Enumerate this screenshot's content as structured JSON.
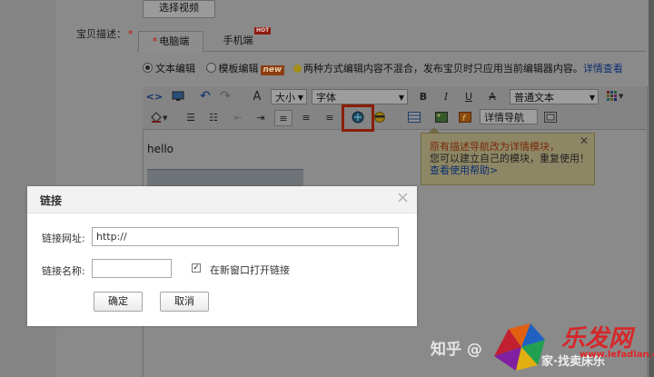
{
  "top": {
    "select_video_label": "选择视频"
  },
  "description": {
    "label": "宝贝描述：",
    "required_mark": "*"
  },
  "tabs": [
    {
      "label": "电脑端",
      "required_mark": "*"
    },
    {
      "label": "手机端",
      "badge": "HOT"
    }
  ],
  "mode": {
    "text_edit_label": "文本编辑",
    "template_edit_label": "模板编辑",
    "template_badge": "new",
    "notice": "两种方式编辑内容不混合，发布宝贝时只应用当前编辑器内容。",
    "notice_link": "详情查看"
  },
  "toolbar": {
    "font_size_label": "大小",
    "font_family_label": "字体",
    "bold_label": "B",
    "italic_label": "I",
    "underline_label": "U",
    "strike_label": "A",
    "paragraph_label": "普通文本",
    "detail_nav_label": "详情导航"
  },
  "editor": {
    "content_text": "hello"
  },
  "tooltip": {
    "line1": "原有描述导航改为详情模块，",
    "line2": "您可以建立自己的模块，重复使用！",
    "help_link": "查看使用帮助>"
  },
  "dialog": {
    "title": "链接",
    "url_label": "链接网址:",
    "url_value": "http://",
    "name_label": "链接名称:",
    "name_value": "",
    "new_window_label": "在新窗口打开链接",
    "new_window_checked": true,
    "ok_label": "确定",
    "cancel_label": "取消"
  },
  "watermark": {
    "zhihu_text": "知乎 @",
    "author_text": "家·找卖床乐",
    "site_text": "乐发网",
    "site_url": "www.lefadian.com.cn"
  },
  "colors": {
    "highlight_box": "#8a1e08",
    "required": "#b8140a",
    "link": "#0c2f70"
  }
}
